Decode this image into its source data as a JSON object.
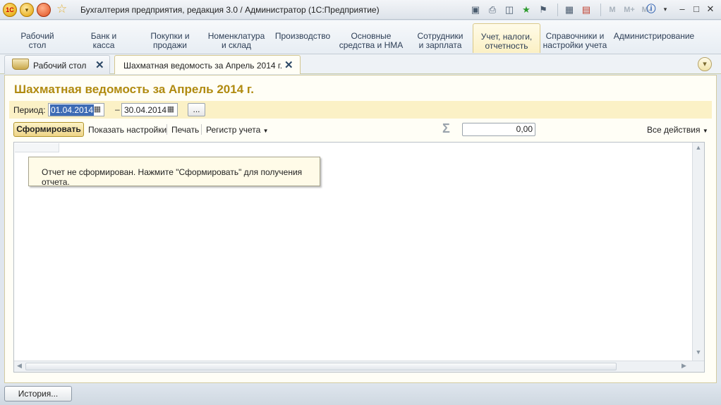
{
  "window": {
    "title": "Бухгалтерия предприятия, редакция 3.0 / Администратор  (1С:Предприятие)",
    "logo_text": "1С"
  },
  "toolbar_icons": [
    "save-icon",
    "print-icon",
    "preview-icon",
    "favorites-add-icon",
    "bookmark-icon",
    "calculator-icon",
    "calendar-icon"
  ],
  "memory_buttons": {
    "m": "M",
    "m_plus": "M+",
    "m_minus": "M-"
  },
  "sections": [
    {
      "label": "Рабочий\nстол"
    },
    {
      "label": "Банк и\nкасса"
    },
    {
      "label": "Покупки и\nпродажи"
    },
    {
      "label": "Номенклатура\nи склад"
    },
    {
      "label": "Производство"
    },
    {
      "label": "Основные\nсредства и НМА"
    },
    {
      "label": "Сотрудники\nи зарплата"
    },
    {
      "label": "Учет, налоги,\nотчетность",
      "active": true
    },
    {
      "label": "Справочники и\nнастройки учета"
    },
    {
      "label": "Администрирование"
    }
  ],
  "open_tabs": [
    {
      "label": "Рабочий стол"
    },
    {
      "label": "Шахматная ведомость за Апрель 2014 г.",
      "active": true
    }
  ],
  "form": {
    "title": "Шахматная ведомость за Апрель 2014 г.",
    "period_label": "Период:",
    "date_from": "01.04.2014",
    "dash": "–",
    "date_to": "30.04.2014",
    "ellipsis": "...",
    "generate_button": "Сформировать",
    "show_settings": "Показать настройки",
    "print": "Печать",
    "register": "Регистр учета",
    "sum_value": "0,00",
    "all_actions": "Все действия",
    "notice": "Отчет не сформирован. Нажмите \"Сформировать\" для получения отчета."
  },
  "status": {
    "history_button": "История..."
  },
  "colors": {
    "accent_title": "#b08a10",
    "period_bar": "#fbf1c6",
    "form_bg": "#fffef6"
  }
}
